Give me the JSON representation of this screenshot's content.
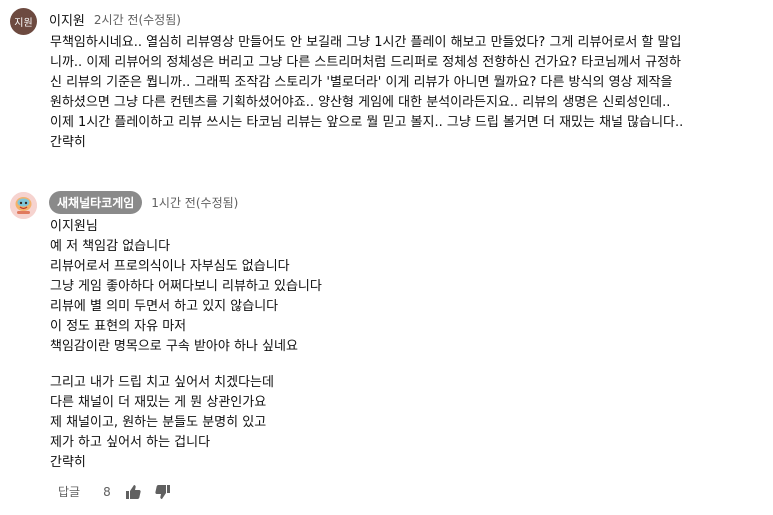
{
  "comments": [
    {
      "avatar_text": "지원",
      "author": "이지원",
      "time": "2시간 전(수정됨)",
      "lines": [
        "무책임하시네요.. 열심히 리뷰영상 만들어도 안 보길래 그냥 1시간 플레이 해보고 만들었다? 그게 리뷰어로서 할 말입",
        "니까.. 이제 리뷰어의 정체성은 버리고 그냥 다른 스트리머처럼 드리퍼로 정체성 전향하신 건가요? 타코님께서 규정하",
        "신 리뷰의 기준은 뭡니까.. 그래픽 조작감 스토리가 '별로더라' 이게 리뷰가 아니면 뭘까요? 다른 방식의 영상 제작을",
        "원하셨으면 그냥 다른 컨텐츠를 기획하셨어야죠.. 양산형 게임에 대한 분석이라든지요.. 리뷰의 생명은 신뢰성인데..",
        "이제 1시간 플레이하고 리뷰 쓰시는 타코님 리뷰는 앞으로 뭘 믿고 볼지.. 그냥 드립 볼거면 더 재밌는 채널 많습니다..",
        "간략히"
      ]
    },
    {
      "author": "새채널타코게임",
      "time": "1시간 전(수정됨)",
      "lines": [
        "이지원님",
        "예 저 책임감 없습니다",
        "리뷰어로서 프로의식이나 자부심도 없습니다",
        "그냥 게임 좋아하다 어쩌다보니 리뷰하고 있습니다",
        "리뷰에 별 의미 두면서 하고 있지 않습니다",
        "이 정도 표현의 자유 마저",
        "책임감이란 명목으로 구속 받아야 하나 싶네요",
        "",
        "그리고 내가 드립 치고 싶어서 치겠다는데",
        "다른 채널이 더 재밌는 게 뭔 상관인가요",
        "제 채널이고, 원하는 분들도 분명히 있고",
        "제가 하고 싶어서 하는 겁니다",
        "간략히"
      ],
      "reply_label": "답글",
      "like_count": "8"
    }
  ],
  "icons": {
    "like": "thumb-up-icon",
    "dislike": "thumb-down-icon"
  }
}
